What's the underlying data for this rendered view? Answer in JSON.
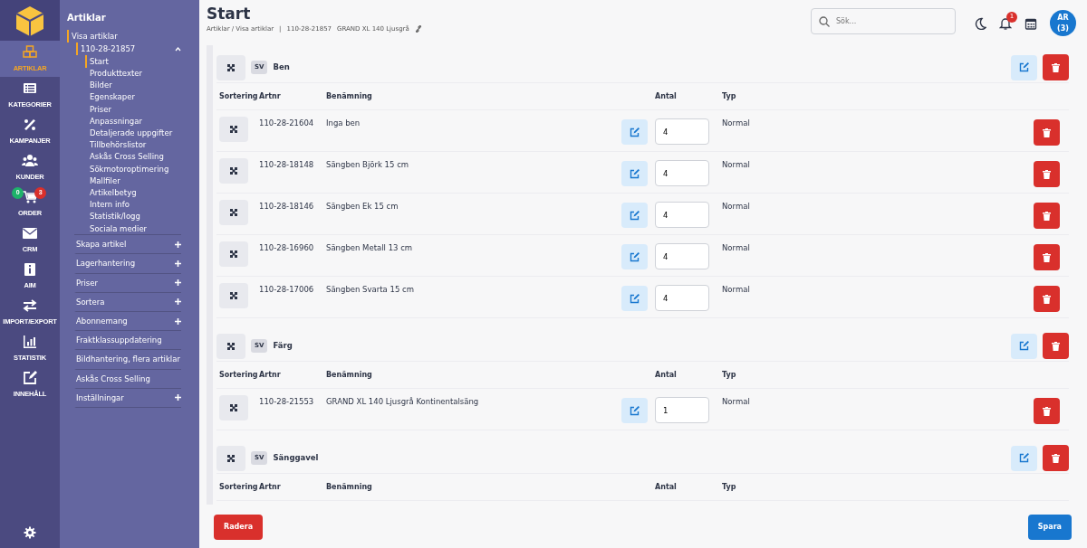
{
  "rail": {
    "items": [
      {
        "label": "ARTIKLAR",
        "selected": true
      },
      {
        "label": "KATEGORIER",
        "selected": false
      },
      {
        "label": "KAMPANJER",
        "selected": false
      },
      {
        "label": "KUNDER",
        "selected": false
      },
      {
        "label": "ORDER",
        "selected": false,
        "badges": [
          {
            "text": "0",
            "color": "#1eb36a"
          },
          {
            "text": "3",
            "color": "#d9302c"
          }
        ]
      },
      {
        "label": "CRM",
        "selected": false
      },
      {
        "label": "AIM",
        "selected": false
      },
      {
        "label": "IMPORT/EXPORT",
        "selected": false
      },
      {
        "label": "STATISTIK",
        "selected": false
      },
      {
        "label": "INNEHÅLL",
        "selected": false
      }
    ]
  },
  "submenu": {
    "title": "Artiklar",
    "items": [
      {
        "label": "Visa artiklar",
        "selected": true,
        "children": [
          {
            "label": "110-28-21857",
            "selected": true,
            "expanded": true,
            "children": [
              {
                "label": "Start",
                "selected": true
              },
              {
                "label": "Produkttexter",
                "selected": false
              },
              {
                "label": "Bilder",
                "selected": false
              },
              {
                "label": "Egenskaper",
                "selected": false
              },
              {
                "label": "Priser",
                "selected": false
              },
              {
                "label": "Anpassningar",
                "selected": false
              },
              {
                "label": "Detaljerade uppgifter",
                "selected": false
              },
              {
                "label": "Tillbehörslistor",
                "selected": false
              },
              {
                "label": "Askås Cross Selling",
                "selected": false
              },
              {
                "label": "Sökmotoroptimering",
                "selected": false
              },
              {
                "label": "Mallfiler",
                "selected": false
              },
              {
                "label": "Artikelbetyg",
                "selected": false
              },
              {
                "label": "Intern info",
                "selected": false
              },
              {
                "label": "Statistik/logg",
                "selected": false
              },
              {
                "label": "Sociala medier",
                "selected": false
              }
            ]
          }
        ]
      },
      {
        "label": "Skapa artikel",
        "selected": false,
        "expanded": false
      },
      {
        "label": "Lagerhantering",
        "selected": false,
        "expanded": false
      },
      {
        "label": "Priser",
        "selected": false,
        "expanded": false
      },
      {
        "label": "Sortera",
        "selected": false,
        "expanded": false
      },
      {
        "label": "Abonnemang",
        "selected": false,
        "expanded": false
      },
      {
        "label": "Fraktklassuppdatering",
        "selected": false
      },
      {
        "label": "Bildhantering, flera artiklar",
        "selected": false
      },
      {
        "label": "Askås Cross Selling",
        "selected": false
      },
      {
        "label": "Inställningar",
        "selected": false,
        "expanded": false
      }
    ]
  },
  "header": {
    "title": "Start",
    "breadcrumb": "Artiklar / Visa artiklar",
    "separator": "|",
    "article_number": "110-28-21857",
    "article_name": "GRAND XL 140 Ljusgrå",
    "search": {
      "placeholder": "Sök..."
    },
    "notifications": "1",
    "avatar": "AR (3)"
  },
  "groups": [
    {
      "language": "SV",
      "name": "Ben",
      "columns": [
        "Sortering",
        "Artnr",
        "Benämning",
        "Antal",
        "Typ"
      ],
      "rows": [
        {
          "artnr": "110-28-21604",
          "name": "Inga ben",
          "antal": "4",
          "typ": "Normal"
        },
        {
          "artnr": "110-28-18148",
          "name": "Sängben Björk 15 cm",
          "antal": "4",
          "typ": "Normal"
        },
        {
          "artnr": "110-28-18146",
          "name": "Sängben Ek 15 cm",
          "antal": "4",
          "typ": "Normal"
        },
        {
          "artnr": "110-28-16960",
          "name": "Sängben Metall 13 cm",
          "antal": "4",
          "typ": "Normal"
        },
        {
          "artnr": "110-28-17006",
          "name": "Sängben Svarta 15 cm",
          "antal": "4",
          "typ": "Normal"
        }
      ]
    },
    {
      "language": "SV",
      "name": "Färg",
      "columns": [
        "Sortering",
        "Artnr",
        "Benämning",
        "Antal",
        "Typ"
      ],
      "rows": [
        {
          "artnr": "110-28-21553",
          "name": "GRAND XL 140 Ljusgrå Kontinentalsäng",
          "antal": "1",
          "typ": "Normal"
        }
      ]
    },
    {
      "language": "SV",
      "name": "Sänggavel",
      "columns": [
        "Sortering",
        "Artnr",
        "Benämning",
        "Antal",
        "Typ"
      ]
    }
  ],
  "footer": {
    "delete_label": "Radera",
    "save_label": "Spara"
  }
}
